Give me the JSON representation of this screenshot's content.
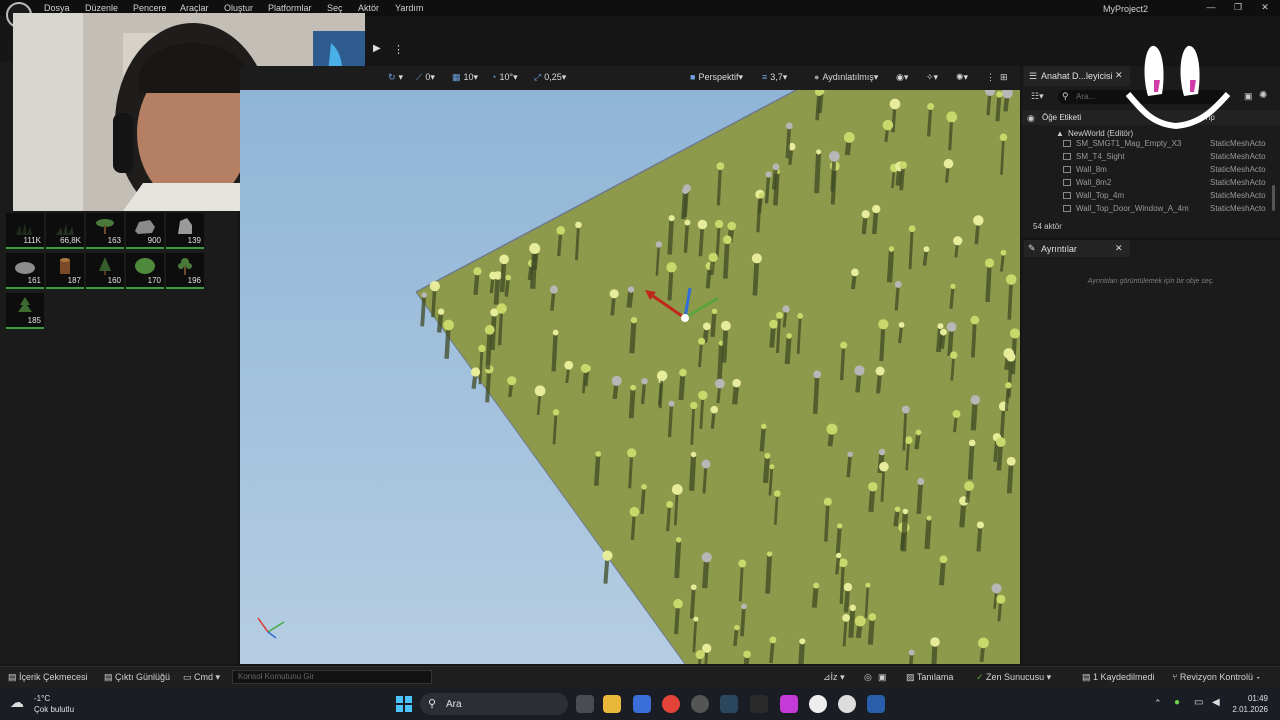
{
  "menu": {
    "items": [
      "Dosya",
      "Düzenle",
      "Pencere",
      "Araçlar",
      "Oluştur",
      "Platformlar",
      "Seç",
      "Aktör",
      "Yardım"
    ],
    "project_name": "MyProject2"
  },
  "viewport_toolbar": {
    "rotation_snap_value": "0",
    "grid_snap_value": "10",
    "angle_snap_value": "10°",
    "scale_snap_value": "0,25",
    "view_mode": "Perspektif",
    "camera_speed": "3,7",
    "lighting_mode": "Aydınlatılmış"
  },
  "foliage": {
    "counts": [
      "111K",
      "66,8K",
      "163",
      "900",
      "139",
      "161",
      "187",
      "160",
      "170",
      "196",
      "185"
    ]
  },
  "outliner": {
    "title": "Anahat D...leyicisi",
    "search_placeholder": "Ara...",
    "column_label": "Öğe Etiketi",
    "column_type": "Tip",
    "world": "NewWorld (Editör)",
    "rows": [
      {
        "name": "SM_SMGT1_Mag_Empty_X3",
        "type": "StaticMeshActo"
      },
      {
        "name": "SM_T4_Sight",
        "type": "StaticMeshActo"
      },
      {
        "name": "Wall_8m",
        "type": "StaticMeshActo"
      },
      {
        "name": "Wall_8m2",
        "type": "StaticMeshActo"
      },
      {
        "name": "Wall_Top_4m",
        "type": "StaticMeshActo"
      },
      {
        "name": "Wall_Top_Door_Window_A_4m",
        "type": "StaticMeshActo"
      }
    ],
    "actor_count": "54 aktör"
  },
  "details": {
    "title": "Ayrıntılar",
    "empty_message": "Ayrıntıları görüntülemek için bir obje seç."
  },
  "statusbar": {
    "content_drawer": "İçerik Çekmecesi",
    "output_log": "Çıktı Günlüğü",
    "cmd": "Cmd",
    "console_placeholder": "Konsol Komutunu Gir",
    "trace": "İz",
    "derived_data": "Tanılama",
    "zen_server": "Zen Sunucusu",
    "unsaved": "1 Kaydedilmedi",
    "revision_control": "Revizyon Kontrolü"
  },
  "taskbar": {
    "weather_temp": "-1°C",
    "weather_desc": "Çok bulutlu",
    "search_label": "Ara",
    "time": "01:49",
    "date": "2.01.2026"
  },
  "colors": {
    "sky": "#9bbbd8",
    "ground": "#8f9a4c",
    "panel": "#1b1b1b",
    "accent_green": "#3e9b3e"
  }
}
